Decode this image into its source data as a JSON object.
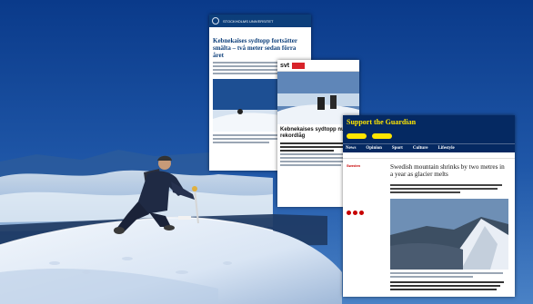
{
  "scene": {
    "description_colors": {
      "sky_top": "#0b3d8f",
      "sky_horizon": "#3f78c0",
      "cloud_sea": "#c9d8e6",
      "snow": "#eef3fa",
      "snow_shadow": "#a9bfdc",
      "guardian_blue": "#052962",
      "guardian_yellow": "#ffe500",
      "svt_red": "#d8232a",
      "su_blue": "#0c3e7a"
    }
  },
  "clip_su": {
    "header": "STOCKHOLMS UNIVERSITET",
    "headline": "Kebnekaises sydtopp fortsätter smälta – två meter sedan förra året"
  },
  "clip_svt": {
    "logo": "svt",
    "headline": "Kebnekaises sydtopp nu rekordlåg"
  },
  "clip_guardian": {
    "support_title": "Support the Guardian",
    "nav": [
      "News",
      "Opinion",
      "Sport",
      "Culture",
      "Lifestyle"
    ],
    "kicker": "Sweden",
    "headline": "Swedish mountain shrinks by two metres in a year as glacier melts"
  }
}
